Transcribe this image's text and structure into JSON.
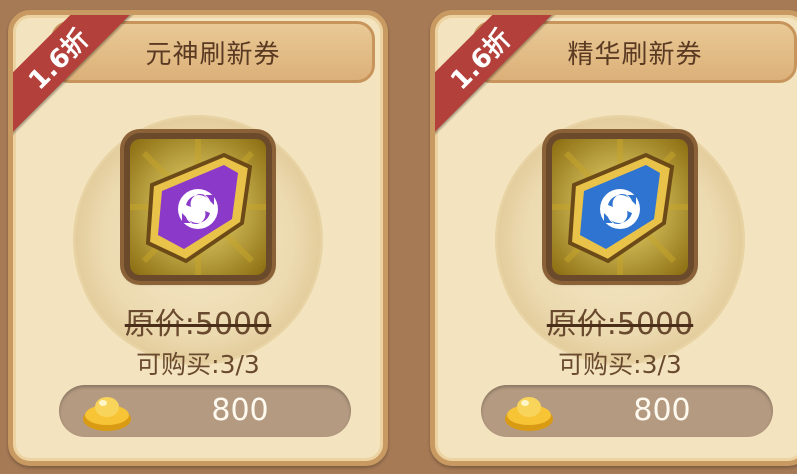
{
  "cards": [
    {
      "discount": "1.6折",
      "title": "元神刷新券",
      "icon": "purple-refresh-ticket",
      "ticket_color": "#8a39c9",
      "original_price": "原价:5000",
      "purchase_limit": "可购买:3/3",
      "price": "800",
      "currency_icon": "gold-ingot"
    },
    {
      "discount": "1.6折",
      "title": "精华刷新券",
      "icon": "blue-refresh-ticket",
      "ticket_color": "#2f74d0",
      "original_price": "原价:5000",
      "purchase_limit": "可购买:3/3",
      "price": "800",
      "currency_icon": "gold-ingot"
    }
  ]
}
